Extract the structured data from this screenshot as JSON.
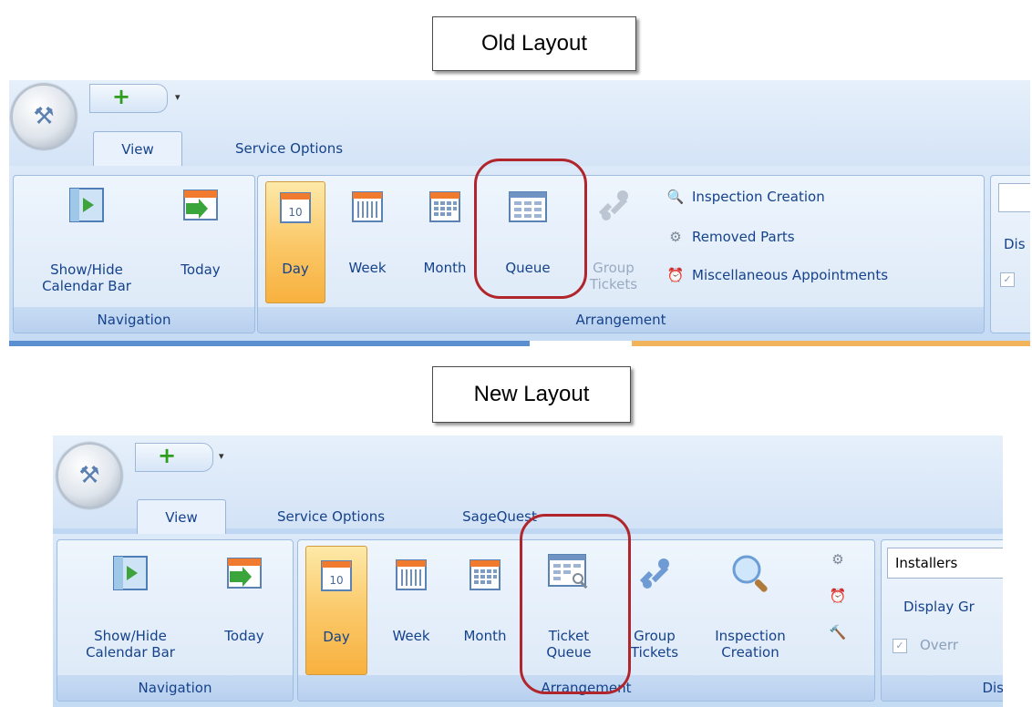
{
  "captions": {
    "old": "Old Layout",
    "new": "New Layout"
  },
  "old": {
    "qat": {
      "add": "+",
      "more": "▾"
    },
    "tabs": [
      "View",
      "Service Options"
    ],
    "navigation": {
      "label": "Navigation",
      "show_hide": "Show/Hide\nCalendar Bar",
      "today": "Today"
    },
    "arrangement": {
      "label": "Arrangement",
      "buttons": [
        "Day",
        "Week",
        "Month",
        "Queue",
        "Group\nTickets"
      ],
      "list": [
        "Inspection Creation",
        "Removed Parts",
        "Miscellaneous Appointments"
      ]
    },
    "cut_label": "Dis"
  },
  "new": {
    "qat": {
      "add": "+",
      "more": "▾"
    },
    "tabs": [
      "View",
      "Service Options",
      "SageQuest"
    ],
    "navigation": {
      "label": "Navigation",
      "show_hide": "Show/Hide\nCalendar Bar",
      "today": "Today"
    },
    "arrangement": {
      "label": "Arrangement",
      "buttons": [
        "Day",
        "Week",
        "Month",
        "Ticket\nQueue",
        "Group\nTickets",
        "Inspection\nCreation"
      ]
    },
    "display": {
      "select_value": "Installers",
      "label_cut": "Display Gr",
      "checkbox_cut": "Overr",
      "group_cut": "Dis"
    }
  },
  "icons": {
    "wrench": "wrench-icon",
    "magnifier": "search-icon",
    "gear": "gear-icon",
    "clock": "alarm-clock-icon",
    "hammer": "hammer-icon"
  },
  "colors": {
    "highlight_ring": "#b0262c",
    "selected_button": "#f7b13e",
    "ribbon_text": "#15428b"
  }
}
